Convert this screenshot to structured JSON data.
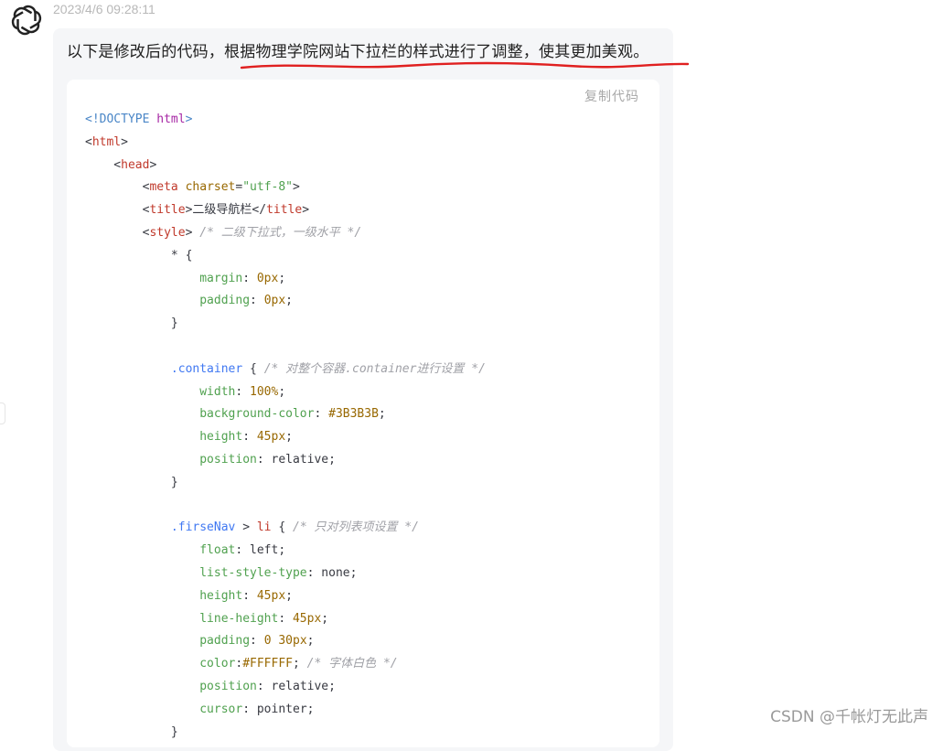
{
  "timestamp": "2023/4/6 09:28:11",
  "message": {
    "prefix": "以下是修改后的代码，",
    "highlight": "根据物理学院网站下拉栏的样式进行了调整，使其更加美观。"
  },
  "code_block": {
    "copy_label": "复制代码",
    "lines": [
      [
        [
          "kw",
          "<!DOCTYPE "
        ],
        [
          "html",
          "html"
        ],
        [
          "kw",
          ">"
        ]
      ],
      [
        [
          "pl",
          "<"
        ],
        [
          "tag",
          "html"
        ],
        [
          "pl",
          ">"
        ]
      ],
      [
        [
          "pl",
          "    <"
        ],
        [
          "tag",
          "head"
        ],
        [
          "pl",
          ">"
        ]
      ],
      [
        [
          "pl",
          "        <"
        ],
        [
          "tag",
          "meta"
        ],
        [
          "pl",
          " "
        ],
        [
          "attr",
          "charset"
        ],
        [
          "pl",
          "="
        ],
        [
          "str",
          "\"utf-8\""
        ],
        [
          "pl",
          ">"
        ]
      ],
      [
        [
          "pl",
          "        <"
        ],
        [
          "tag",
          "title"
        ],
        [
          "pl",
          ">二级导航栏</"
        ],
        [
          "tag",
          "title"
        ],
        [
          "pl",
          ">"
        ]
      ],
      [
        [
          "pl",
          "        <"
        ],
        [
          "tag",
          "style"
        ],
        [
          "pl",
          "> "
        ],
        [
          "cmt",
          "/* 二级下拉式，一级水平 */"
        ]
      ],
      [
        [
          "pl",
          "            * {"
        ]
      ],
      [
        [
          "pl",
          "                "
        ],
        [
          "prop",
          "margin"
        ],
        [
          "pl",
          ": "
        ],
        [
          "num",
          "0px"
        ],
        [
          "pl",
          ";"
        ]
      ],
      [
        [
          "pl",
          "                "
        ],
        [
          "prop",
          "padding"
        ],
        [
          "pl",
          ": "
        ],
        [
          "num",
          "0px"
        ],
        [
          "pl",
          ";"
        ]
      ],
      [
        [
          "pl",
          "            }"
        ]
      ],
      [
        [
          "pl",
          ""
        ]
      ],
      [
        [
          "pl",
          "            "
        ],
        [
          "sel",
          ".container"
        ],
        [
          "pl",
          " { "
        ],
        [
          "cmt",
          "/* 对整个容器.container进行设置 */"
        ]
      ],
      [
        [
          "pl",
          "                "
        ],
        [
          "prop",
          "width"
        ],
        [
          "pl",
          ": "
        ],
        [
          "num",
          "100%"
        ],
        [
          "pl",
          ";"
        ]
      ],
      [
        [
          "pl",
          "                "
        ],
        [
          "prop",
          "background-color"
        ],
        [
          "pl",
          ": "
        ],
        [
          "num",
          "#3B3B3B"
        ],
        [
          "pl",
          ";"
        ]
      ],
      [
        [
          "pl",
          "                "
        ],
        [
          "prop",
          "height"
        ],
        [
          "pl",
          ": "
        ],
        [
          "num",
          "45px"
        ],
        [
          "pl",
          ";"
        ]
      ],
      [
        [
          "pl",
          "                "
        ],
        [
          "prop",
          "position"
        ],
        [
          "pl",
          ": relative;"
        ]
      ],
      [
        [
          "pl",
          "            }"
        ]
      ],
      [
        [
          "pl",
          ""
        ]
      ],
      [
        [
          "pl",
          "            "
        ],
        [
          "sel",
          ".firseNav"
        ],
        [
          "pl",
          " > "
        ],
        [
          "tag",
          "li"
        ],
        [
          "pl",
          " { "
        ],
        [
          "cmt",
          "/* 只对列表项设置 */"
        ]
      ],
      [
        [
          "pl",
          "                "
        ],
        [
          "prop",
          "float"
        ],
        [
          "pl",
          ": left;"
        ]
      ],
      [
        [
          "pl",
          "                "
        ],
        [
          "prop",
          "list-style-type"
        ],
        [
          "pl",
          ": none;"
        ]
      ],
      [
        [
          "pl",
          "                "
        ],
        [
          "prop",
          "height"
        ],
        [
          "pl",
          ": "
        ],
        [
          "num",
          "45px"
        ],
        [
          "pl",
          ";"
        ]
      ],
      [
        [
          "pl",
          "                "
        ],
        [
          "prop",
          "line-height"
        ],
        [
          "pl",
          ": "
        ],
        [
          "num",
          "45px"
        ],
        [
          "pl",
          ";"
        ]
      ],
      [
        [
          "pl",
          "                "
        ],
        [
          "prop",
          "padding"
        ],
        [
          "pl",
          ": "
        ],
        [
          "num",
          "0 30px"
        ],
        [
          "pl",
          ";"
        ]
      ],
      [
        [
          "pl",
          "                "
        ],
        [
          "prop",
          "color"
        ],
        [
          "pl",
          ":"
        ],
        [
          "num",
          "#FFFFFF"
        ],
        [
          "pl",
          "; "
        ],
        [
          "cmt",
          "/* 字体白色 */"
        ]
      ],
      [
        [
          "pl",
          "                "
        ],
        [
          "prop",
          "position"
        ],
        [
          "pl",
          ": relative;"
        ]
      ],
      [
        [
          "pl",
          "                "
        ],
        [
          "prop",
          "cursor"
        ],
        [
          "pl",
          ": pointer;"
        ]
      ],
      [
        [
          "pl",
          "            }"
        ]
      ]
    ]
  },
  "watermark": "CSDN @千帐灯无此声",
  "colors": {
    "underline": "#e02020",
    "bubble_bg": "#f5f6f8",
    "code_bg": "#ffffff"
  },
  "icons": {
    "avatar": "openai-logo-icon"
  }
}
